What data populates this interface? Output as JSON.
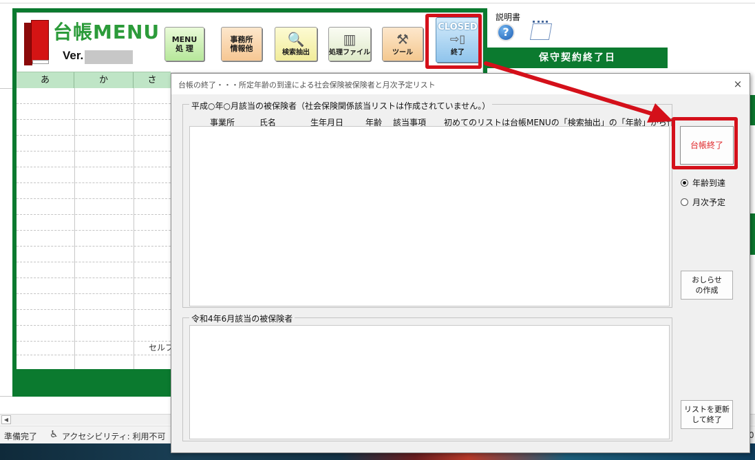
{
  "app": {
    "title": "台帳MENU",
    "version_label": "Ver.",
    "version_value_redacted": true
  },
  "toolbar": {
    "menu_btn": {
      "line1": "MENU",
      "line2": "処 理"
    },
    "office_btn": {
      "line1": "事務所",
      "line2": "情報他"
    },
    "search_btn": {
      "label": "検索抽出",
      "icon": "magnifier-icon"
    },
    "files_btn": {
      "label": "処理ファイル",
      "icon": "file-cabinet-icon"
    },
    "tools_btn": {
      "label": "ツール",
      "icon": "toolbox-icon"
    },
    "closed_btn": {
      "top": "CLOSED",
      "label": "終了",
      "icon": "exit-door-icon"
    }
  },
  "grid": {
    "headers": [
      "あ",
      "か",
      "さ"
    ],
    "partial_text": "セルフ"
  },
  "right_panel": {
    "manual_label": "説明書",
    "header": "保守契約終了日"
  },
  "dialog": {
    "title": "台帳の終了・・・所定年齢の到達による社会保険被保険者と月次予定リスト",
    "close_glyph": "×",
    "group1": {
      "label": "平成○年○月該当の被保険者（社会保険関係該当リストは作成されていません。）",
      "columns": [
        "事業所",
        "氏名",
        "生年月日",
        "年齢",
        "該当事項",
        "初めてのリストは台帳MENUの「検索抽出」の「年齢」から作成してくだ"
      ]
    },
    "group2": {
      "label": "令和4年6月該当の被保険者"
    },
    "buttons": {
      "end": "台帳終了",
      "notice_line1": "おしらせ",
      "notice_line2": "の作成",
      "refresh_line1": "リストを更新",
      "refresh_line2": "して終了"
    },
    "radios": [
      {
        "label": "年齢到達",
        "checked": true
      },
      {
        "label": "月次予定",
        "checked": false
      }
    ]
  },
  "statusbar": {
    "ready": "準備完了",
    "accessibility": "アクセシビリティ: 利用不可",
    "right_fragment": "0"
  },
  "colors": {
    "menu_green": "#0b7a2f",
    "highlight_red": "#d4101a",
    "end_button_text": "#e0282b"
  }
}
